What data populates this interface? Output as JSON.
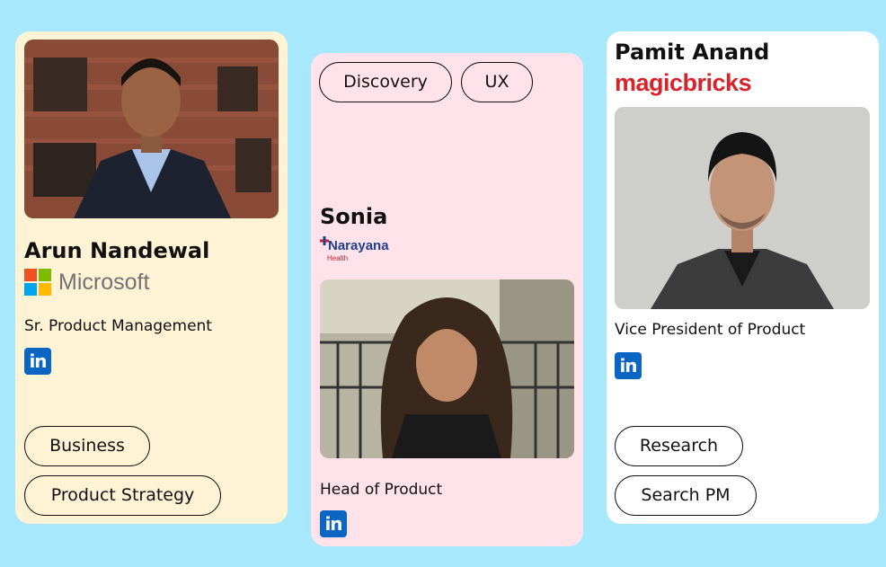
{
  "cards": [
    {
      "name": "Arun Nandewal",
      "company": "Microsoft",
      "role": "Sr. Product Management",
      "linkedin_label": "in",
      "tags": [
        "Business",
        "Product Strategy"
      ]
    },
    {
      "name": "Sonia",
      "company": "Narayana",
      "company_sub": "Health",
      "role": "Head of Product",
      "linkedin_label": "in",
      "tags": [
        "Discovery",
        "UX"
      ]
    },
    {
      "name": "Pamit Anand",
      "company": "magicbricks",
      "role": "Vice President of Product",
      "linkedin_label": "in",
      "tags": [
        "Research",
        "Search PM"
      ]
    }
  ],
  "colors": {
    "background": "#a8e8fc",
    "card1": "#fff3d6",
    "card2": "#ffe2ea",
    "card3": "#ffffff",
    "linkedin": "#0a66c2",
    "magicbricks": "#d8232a"
  }
}
